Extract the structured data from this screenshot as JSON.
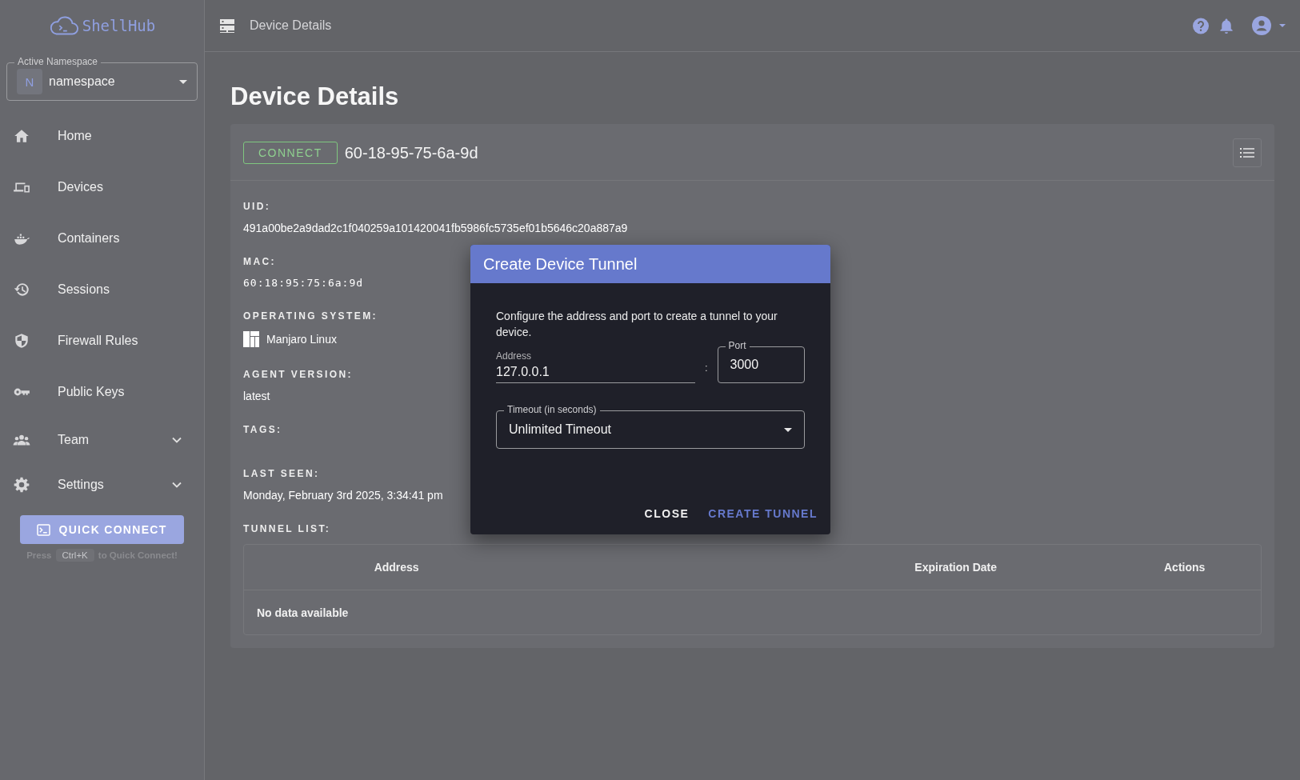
{
  "sidebar": {
    "logo": "ShellHub",
    "namespace": {
      "label": "Active Namespace",
      "initial": "N",
      "value": "namespace"
    },
    "items": [
      {
        "label": "Home",
        "has_submenu": false
      },
      {
        "label": "Devices",
        "has_submenu": false
      },
      {
        "label": "Containers",
        "has_submenu": false
      },
      {
        "label": "Sessions",
        "has_submenu": false
      },
      {
        "label": "Firewall Rules",
        "has_submenu": false
      },
      {
        "label": "Public Keys",
        "has_submenu": false
      },
      {
        "label": "Team",
        "has_submenu": true
      },
      {
        "label": "Settings",
        "has_submenu": true
      }
    ],
    "quick_connect": {
      "button": "QUICK CONNECT",
      "hint_before": "Press",
      "key": "Ctrl+K",
      "hint_after": "to Quick Connect!"
    }
  },
  "header": {
    "title": "Device Details"
  },
  "page": {
    "title": "Device Details",
    "device": {
      "connect": "CONNECT",
      "name": "60-18-95-75-6a-9d",
      "fields": [
        {
          "kind": "text",
          "label": "UID:",
          "value": "491a00be2a9dad2c1f040259a101420041fb5986fc5735ef01b5646c20a887a9"
        },
        {
          "kind": "mono",
          "label": "MAC:",
          "value": "60:18:95:75:6a:9d"
        },
        {
          "kind": "os",
          "label": "OPERATING SYSTEM:",
          "value": "Manjaro Linux"
        },
        {
          "kind": "text",
          "label": "AGENT VERSION:",
          "value": "latest"
        },
        {
          "kind": "empty",
          "label": "TAGS:"
        },
        {
          "kind": "text",
          "label": "LAST SEEN:",
          "value": "Monday, February 3rd 2025, 3:34:41 pm"
        }
      ],
      "tunnels": {
        "label": "TUNNEL LIST:",
        "columns": [
          "Address",
          "Expiration Date",
          "Actions"
        ],
        "empty": "No data available"
      }
    }
  },
  "dialog": {
    "title": "Create Device Tunnel",
    "text": "Configure the address and port to create a tunnel to your device.",
    "address": {
      "label": "Address",
      "value": "127.0.0.1"
    },
    "separator": ":",
    "port": {
      "label": "Port",
      "value": "3000"
    },
    "timeout": {
      "label": "Timeout (in seconds)",
      "value": "Unlimited Timeout"
    },
    "buttons": [
      "CLOSE",
      "CREATE TUNNEL"
    ]
  }
}
